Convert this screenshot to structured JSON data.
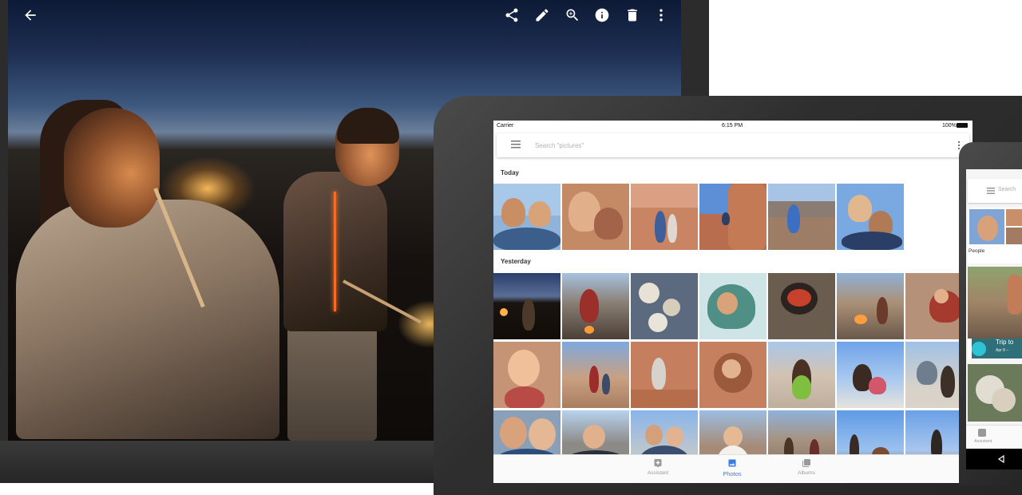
{
  "viewer": {
    "toolbar": {
      "back_icon": "arrow-left-icon",
      "actions": [
        "share-icon",
        "edit-pencil-icon",
        "zoom-in-icon",
        "info-icon",
        "delete-trash-icon",
        "more-vertical-icon"
      ]
    }
  },
  "tablet": {
    "status": {
      "carrier": "Carrier",
      "time": "6:15 PM",
      "battery": "100%"
    },
    "search": {
      "placeholder": "Search \"pictures\""
    },
    "sections": {
      "today": "Today",
      "yesterday": "Yesterday"
    },
    "nav": {
      "assistant": "Assistant",
      "photos": "Photos",
      "albums": "Albums"
    },
    "colors": {
      "accent": "#3a7be0"
    }
  },
  "phone": {
    "search_text": "Search",
    "people_label": "People",
    "trip_title": "Trip to",
    "trip_date": "Apr 8 – ",
    "nav_assistant": "Assistant"
  }
}
